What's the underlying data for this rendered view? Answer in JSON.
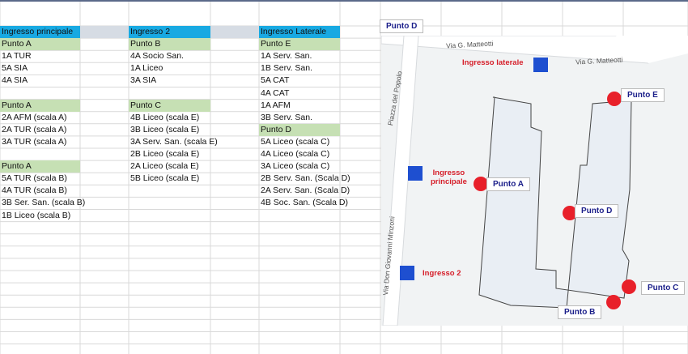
{
  "columns": [
    {
      "header": "Ingresso principale",
      "rows": [
        {
          "text": "Punto A",
          "style": "green"
        },
        {
          "text": "1A TUR"
        },
        {
          "text": "5A SIA"
        },
        {
          "text": "4A SIA"
        },
        {
          "text": ""
        },
        {
          "text": "Punto A",
          "style": "green"
        },
        {
          "text": "2A AFM (scala A)"
        },
        {
          "text": "2A TUR (scala A)"
        },
        {
          "text": "3A TUR (scala A)"
        },
        {
          "text": ""
        },
        {
          "text": "Punto A",
          "style": "green"
        },
        {
          "text": "5A TUR (scala B)"
        },
        {
          "text": "4A TUR (scala B)"
        },
        {
          "text": "3B Ser. San. (scala B)"
        },
        {
          "text": "1B Liceo (scala B)"
        }
      ]
    },
    {
      "header": "Ingresso 2",
      "rows": [
        {
          "text": "Punto B",
          "style": "green"
        },
        {
          "text": "4A Socio San."
        },
        {
          "text": "1A Liceo"
        },
        {
          "text": "3A SIA"
        },
        {
          "text": ""
        },
        {
          "text": "Punto C",
          "style": "green"
        },
        {
          "text": "4B Liceo (scala E)"
        },
        {
          "text": "3B Liceo (scala E)"
        },
        {
          "text": "3A Serv. San. (scala E)"
        },
        {
          "text": "2B Liceo (scala E)"
        },
        {
          "text": "2A Liceo (scala E)"
        },
        {
          "text": "5B Liceo (scala E)"
        }
      ]
    },
    {
      "header": "Ingresso Laterale",
      "rows": [
        {
          "text": "Punto E",
          "style": "green"
        },
        {
          "text": "1A Serv. San."
        },
        {
          "text": "1B Serv. San."
        },
        {
          "text": "5A CAT"
        },
        {
          "text": "4A CAT"
        },
        {
          "text": "1A AFM"
        },
        {
          "text": "3B Serv. San."
        },
        {
          "text": "Punto D",
          "style": "green"
        },
        {
          "text": "5A Liceo (scala C)"
        },
        {
          "text": "4A Liceo (scala C)"
        },
        {
          "text": "3A Liceo (scala C)"
        },
        {
          "text": "2B Serv. San. (Scala D)"
        },
        {
          "text": "2A Serv. San. (Scala D)"
        },
        {
          "text": "4B Soc. San. (Scala D)"
        }
      ]
    }
  ],
  "map": {
    "labels": {
      "punto_d_top": "Punto D",
      "punto_a": "Punto A",
      "punto_b": "Punto B",
      "punto_c": "Punto C",
      "punto_d": "Punto D",
      "punto_e": "Punto E"
    },
    "entrances": {
      "laterale": "Ingresso laterale",
      "principale": "Ingresso\nprincipale",
      "secondo": "Ingresso 2"
    },
    "streets": {
      "matteotti_left": "Via G. Matteotti",
      "matteotti_right": "Via G. Matteotti",
      "popolo": "Piazza del Popolo",
      "minzoni": "Via Don Giovanni Minzoni"
    },
    "colors": {
      "red": "#e8202a",
      "blue": "#1e4fd0",
      "building": "#e9eef4"
    }
  }
}
